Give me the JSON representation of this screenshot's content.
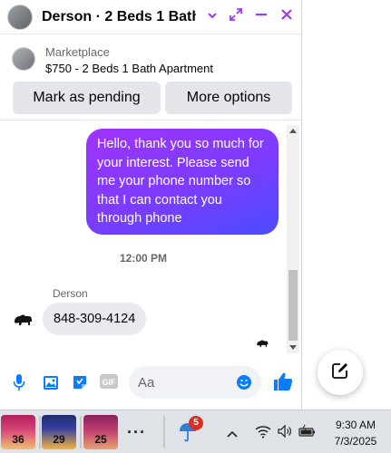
{
  "header": {
    "title": "Derson · 2 Beds 1 Bath..."
  },
  "marketplace": {
    "label": "Marketplace",
    "listing": "$750 - 2 Beds 1 Bath Apartment",
    "mark_pending": "Mark as pending",
    "more_options": "More options"
  },
  "messages": {
    "outgoing": "Hello, thank you so much for your interest. Please send me your phone number so that I can contact you through phone",
    "timestamp": "12:00 PM",
    "sender": "Derson",
    "incoming": "848-309-4124"
  },
  "composer": {
    "placeholder": "Aa",
    "gif_label": "GIF"
  },
  "taskbar": {
    "apps": [
      {
        "icon": "weather-app-icon",
        "value": "36"
      },
      {
        "icon": "weather-app-icon",
        "value": "29"
      },
      {
        "icon": "weather-app-icon",
        "value": "25"
      }
    ],
    "more_label": "···",
    "notification_count": "5",
    "time": "9:30 AM",
    "date": "7/3/2025"
  },
  "colors": {
    "accent": "#a334fa",
    "messenger_blue": "#0a7cff",
    "bubble_gradient_start": "#a033ff",
    "bubble_gradient_end": "#4a4cff"
  }
}
